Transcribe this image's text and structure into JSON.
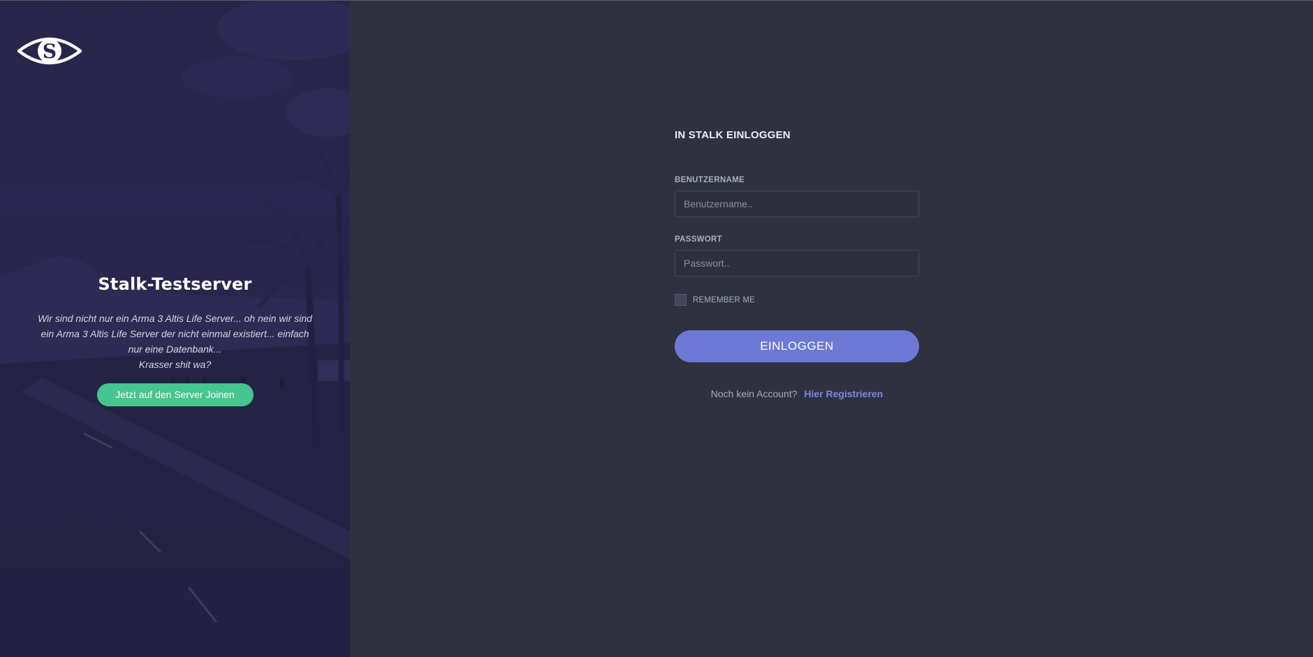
{
  "brand": {
    "logo_icon": "stalk-eye-logo-icon",
    "server_name": "Stalk-Testserver",
    "description_lines": [
      "Wir sind nicht nur ein Arma 3 Altis Life Server... oh nein wir sind",
      "ein Arma 3 Altis Life Server der nicht einmal existiert... einfach",
      "nur eine Datenbank...",
      "Krasser shit wa?"
    ],
    "join_button_label": "Jetzt auf den Server Joinen"
  },
  "login": {
    "title": "IN STALK EINLOGGEN",
    "username_label": "BENUTZERNAME",
    "username_placeholder": "Benutzername..",
    "password_label": "PASSWORT",
    "password_placeholder": "Passwort..",
    "remember_label": "REMEMBER ME",
    "remember_checked": false,
    "submit_label": "EINLOGGEN",
    "no_account_text": "Noch kein Account?",
    "register_link_text": "Hier Registrieren"
  },
  "colors": {
    "background": "#2f3140",
    "left_panel_tint": "#2b2950",
    "join_button": "#46c58f",
    "login_button": "#6d79d4",
    "register_link": "#7d87e6"
  }
}
